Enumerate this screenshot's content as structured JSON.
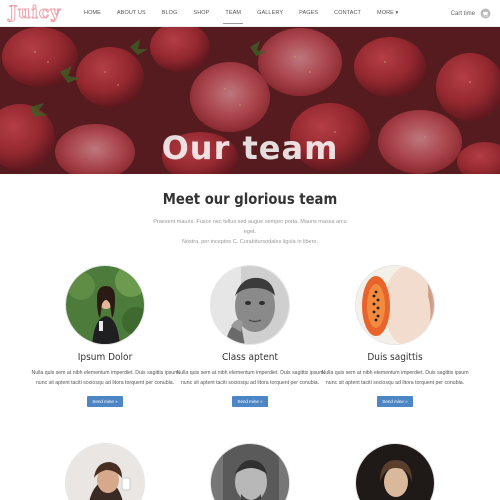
{
  "brand": {
    "logo": "Juicy"
  },
  "nav": {
    "items": [
      "HOME",
      "ABOUT US",
      "BLOG",
      "SHOP",
      "TEAM",
      "GALLERY",
      "PAGES",
      "CONTACT",
      "MORE ▾"
    ],
    "active": "TEAM"
  },
  "cart": {
    "label": "Cart time"
  },
  "hero": {
    "title": "Our team"
  },
  "section": {
    "title": "Meet our glorious team",
    "desc_line1": "Praesent mauris. Fusce nec tellus sed augue semper porta. Mauris massa arcu eget.",
    "desc_line2": "Nostra, per inceptos C. Curabitursodales ligula in libero."
  },
  "team": [
    {
      "name": "Ipsum Dolor",
      "text": "Nulla quis sem at nibh elementum imperdiet. Duis sagittis ipsum nunc sit aptent taciti sociosqu ad litora torquent per conubia.",
      "button": "Send mine »"
    },
    {
      "name": "Class aptent",
      "text": "Nulla quis sem at nibh elementum imperdiet. Duis sagittis ipsum nunc sit aptent taciti sociosqu ad litora torquent per conubia.",
      "button": "Send mine »"
    },
    {
      "name": "Duis sagittis",
      "text": "Nulla quis sem at nibh elementum imperdiet. Duis sagittis ipsum nunc sit aptent taciti sociosqu ad litora torquent per conubia.",
      "button": "Send mine »"
    }
  ],
  "colors": {
    "accent": "#4d86c4",
    "logo": "#f0a3ad",
    "hero": "#7a2b2d"
  }
}
